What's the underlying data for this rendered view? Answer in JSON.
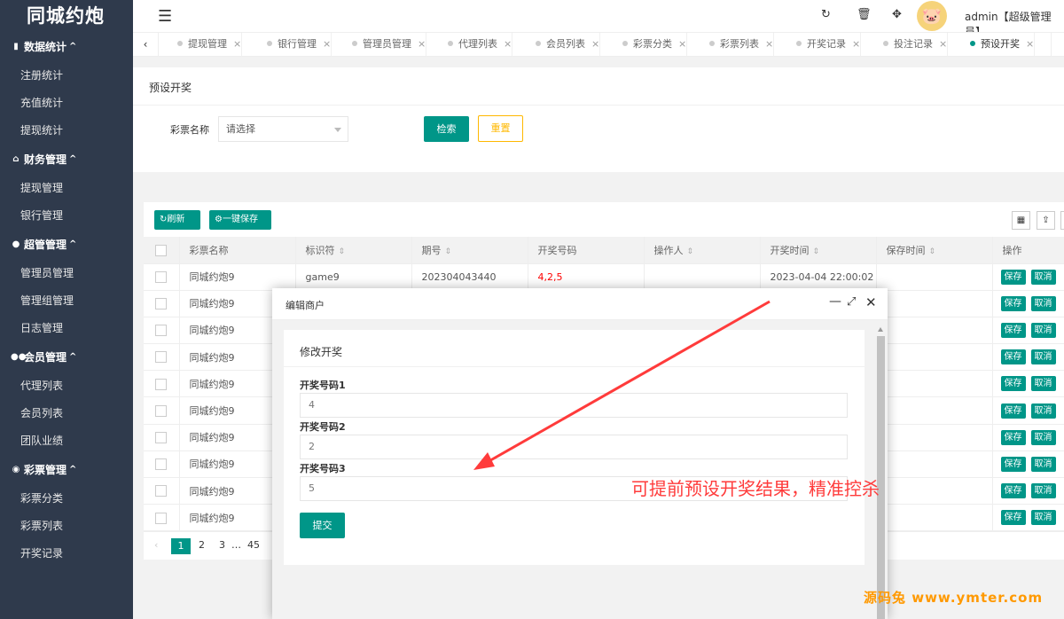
{
  "app": {
    "logo": "同城约炮"
  },
  "sidebar": {
    "groups": [
      {
        "title": "数据统计",
        "icon": "bar-chart-icon",
        "items": [
          "注册统计",
          "充值统计",
          "提现统计"
        ]
      },
      {
        "title": "财务管理",
        "icon": "bank-icon",
        "items": [
          "提现管理",
          "银行管理"
        ]
      },
      {
        "title": "超管管理",
        "icon": "user-icon",
        "items": [
          "管理员管理",
          "管理组管理",
          "日志管理"
        ]
      },
      {
        "title": "会员管理",
        "icon": "users-icon",
        "items": [
          "代理列表",
          "会员列表",
          "团队业绩"
        ]
      },
      {
        "title": "彩票管理",
        "icon": "gamepad-icon",
        "items": [
          "彩票分类",
          "彩票列表",
          "开奖记录"
        ]
      }
    ]
  },
  "header": {
    "admin_label": "admin【超级管理员】"
  },
  "tabs": [
    "提现管理",
    "银行管理",
    "管理员管理",
    "代理列表",
    "会员列表",
    "彩票分类",
    "彩票列表",
    "开奖记录",
    "投注记录",
    "预设开奖"
  ],
  "page": {
    "title": "预设开奖",
    "search_label": "彩票名称",
    "select_placeholder": "请选择",
    "search_button": "检索",
    "reset_button": "重置"
  },
  "toolbar": {
    "refresh": "刷新",
    "save_all": "一键保存"
  },
  "table": {
    "columns": [
      "彩票名称",
      "标识符",
      "期号",
      "开奖号码",
      "操作人",
      "开奖时间",
      "保存时间",
      "操作"
    ],
    "rows": [
      {
        "name": "同城约炮9",
        "code": "game9",
        "period": "202304043440",
        "number": "4,2,5",
        "operator": "",
        "time": "2023-04-04 22:00:02",
        "saved": ""
      },
      {
        "name": "同城约炮9"
      },
      {
        "name": "同城约炮9"
      },
      {
        "name": "同城约炮9"
      },
      {
        "name": "同城约炮9"
      },
      {
        "name": "同城约炮9"
      },
      {
        "name": "同城约炮9"
      },
      {
        "name": "同城约炮9"
      },
      {
        "name": "同城约炮9"
      },
      {
        "name": "同城约炮9"
      }
    ],
    "row_actions": {
      "save": "保存",
      "cancel": "取消"
    }
  },
  "pagination": {
    "current": "1",
    "p2": "2",
    "p3": "3",
    "ellipsis": "…",
    "last": "45"
  },
  "modal": {
    "title": "编辑商户",
    "card_title": "修改开奖",
    "fields": [
      {
        "label": "开奖号码1",
        "value": "4"
      },
      {
        "label": "开奖号码2",
        "value": "2"
      },
      {
        "label": "开奖号码3",
        "value": "5"
      }
    ],
    "submit": "提交"
  },
  "annotation": "可提前预设开奖结果，精准控杀",
  "watermark": "源码兔 www.ymter.com",
  "colors": {
    "primary": "#009688",
    "sidebar": "#2f3a4c",
    "warning": "#ffb800",
    "annotation": "#ff3b3b",
    "watermark": "#ff9900"
  }
}
